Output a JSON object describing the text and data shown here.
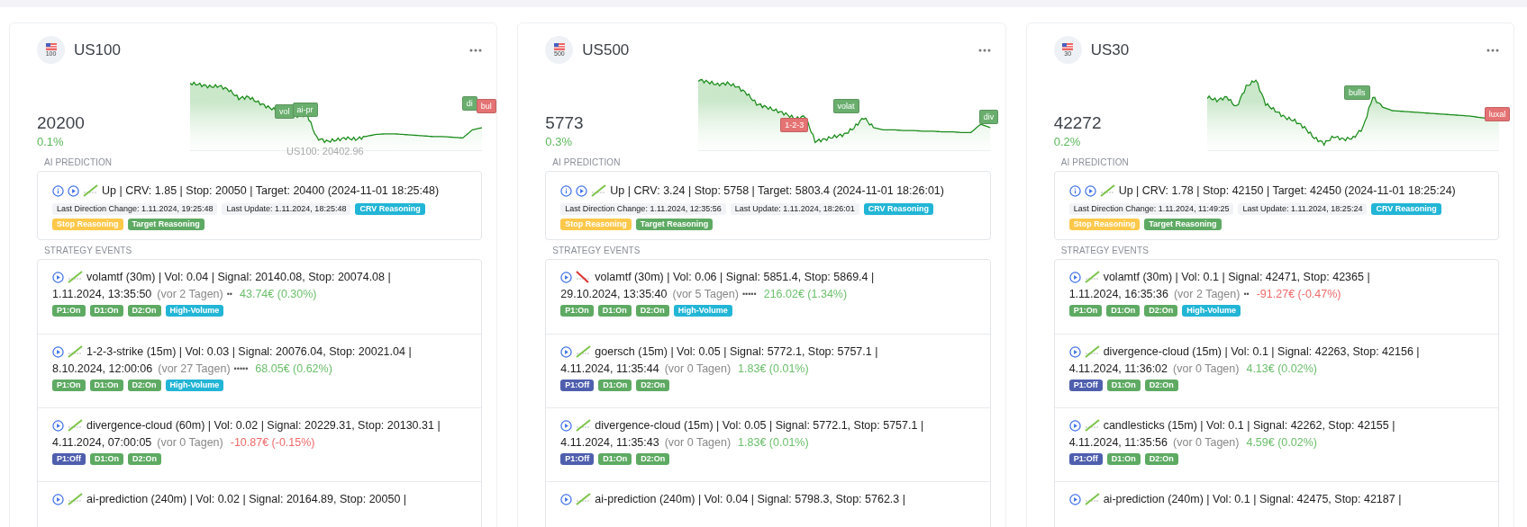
{
  "cards": [
    {
      "symbol": "US100",
      "flag_label": "100",
      "price": "20200",
      "change": "0.1%",
      "chart_markers": [
        {
          "label": "vol",
          "color": "#6aae6e"
        },
        {
          "label": "ai-pr",
          "color": "#6aae6e"
        },
        {
          "label": "di",
          "color": "#6aae6e"
        },
        {
          "label": "bul",
          "color": "#e57373"
        }
      ],
      "tooltip": {
        "series": "US100:",
        "value": "20402.96"
      },
      "section_prediction": "AI PREDICTION",
      "prediction": {
        "rising": true,
        "summary": "Up | CRV: 1.85 | Stop: 20050 | Target: 20400 (2024-11-01 18:25:48)",
        "tags": [
          {
            "kind": "info",
            "label": "Last Direction Change: 1.11.2024, 19:25:48"
          },
          {
            "kind": "info",
            "label": "Last Update: 1.11.2024, 18:25:48"
          },
          {
            "kind": "crv",
            "label": "CRV Reasoning"
          },
          {
            "kind": "stop",
            "label": "Stop Reasoning"
          },
          {
            "kind": "target",
            "label": "Target Reasoning"
          }
        ]
      },
      "section_events": "STRATEGY EVENTS",
      "events": [
        {
          "rising": true,
          "title": "volamtf (30m) | Vol: 0.04 | Signal: 20140.08, Stop: 20074.08 |",
          "date": "1.11.2024, 13:35:50",
          "age": "(vor 2 Tagen)",
          "dots": "••",
          "pnl": "43.74€ (0.30%)",
          "negative": false,
          "tags": [
            {
              "kind": "on",
              "label": "P1:On"
            },
            {
              "kind": "on",
              "label": "D1:On"
            },
            {
              "kind": "on",
              "label": "D2:On"
            },
            {
              "kind": "volume",
              "label": "High-Volume"
            }
          ]
        },
        {
          "rising": true,
          "title": "1-2-3-strike (15m) | Vol: 0.03 | Signal: 20076.04, Stop: 20021.04 |",
          "date": "8.10.2024, 12:00:06",
          "age": "(vor 27 Tagen)",
          "dots": "•••••",
          "pnl": "68.05€ (0.62%)",
          "negative": false,
          "tags": [
            {
              "kind": "on",
              "label": "P1:On"
            },
            {
              "kind": "on",
              "label": "D1:On"
            },
            {
              "kind": "on",
              "label": "D2:On"
            },
            {
              "kind": "volume",
              "label": "High-Volume"
            }
          ]
        },
        {
          "rising": true,
          "title": "divergence-cloud (60m) | Vol: 0.02 | Signal: 20229.31, Stop: 20130.31 |",
          "date": "4.11.2024, 07:00:05",
          "age": "(vor 0 Tagen)",
          "pnl": "-10.87€ (-0.15%)",
          "negative": true,
          "tags": [
            {
              "kind": "off",
              "label": "P1:Off"
            },
            {
              "kind": "on",
              "label": "D1:On"
            },
            {
              "kind": "on",
              "label": "D2:On"
            }
          ]
        },
        {
          "rising": true,
          "title": "ai-prediction (240m) | Vol: 0.02 | Signal: 20164.89, Stop: 20050 |"
        }
      ]
    },
    {
      "symbol": "US500",
      "flag_label": "500",
      "price": "5773",
      "change": "0.3%",
      "chart_markers": [
        {
          "label": "1-2-3",
          "color": "#e57373"
        },
        {
          "label": "volat",
          "color": "#6aae6e"
        },
        {
          "label": "div",
          "color": "#6aae6e"
        }
      ],
      "section_prediction": "AI PREDICTION",
      "prediction": {
        "rising": true,
        "summary": "Up | CRV: 3.24 | Stop: 5758 | Target: 5803.4 (2024-11-01 18:26:01)",
        "tags": [
          {
            "kind": "info",
            "label": "Last Direction Change: 1.11.2024, 12:35:56"
          },
          {
            "kind": "info",
            "label": "Last Update: 1.11.2024, 18:26:01"
          },
          {
            "kind": "crv",
            "label": "CRV Reasoning"
          },
          {
            "kind": "stop",
            "label": "Stop Reasoning"
          },
          {
            "kind": "target",
            "label": "Target Reasoning"
          }
        ]
      },
      "section_events": "STRATEGY EVENTS",
      "events": [
        {
          "rising": false,
          "title": "volamtf (30m) | Vol: 0.06 | Signal: 5851.4, Stop: 5869.4 |",
          "date": "29.10.2024, 13:35:40",
          "age": "(vor 5 Tagen)",
          "dots": "•••••",
          "pnl": "216.02€ (1.34%)",
          "negative": false,
          "tags": [
            {
              "kind": "on",
              "label": "P1:On"
            },
            {
              "kind": "on",
              "label": "D1:On"
            },
            {
              "kind": "on",
              "label": "D2:On"
            },
            {
              "kind": "volume",
              "label": "High-Volume"
            }
          ]
        },
        {
          "rising": true,
          "title": "goersch (15m) | Vol: 0.05 | Signal: 5772.1, Stop: 5757.1 |",
          "date": "4.11.2024, 11:35:44",
          "age": "(vor 0 Tagen)",
          "pnl": "1.83€ (0.01%)",
          "negative": false,
          "tags": [
            {
              "kind": "off",
              "label": "P1:Off"
            },
            {
              "kind": "on",
              "label": "D1:On"
            },
            {
              "kind": "on",
              "label": "D2:On"
            }
          ]
        },
        {
          "rising": true,
          "title": "divergence-cloud (15m) | Vol: 0.05 | Signal: 5772.1, Stop: 5757.1 |",
          "date": "4.11.2024, 11:35:43",
          "age": "(vor 0 Tagen)",
          "pnl": "1.83€ (0.01%)",
          "negative": false,
          "tags": [
            {
              "kind": "off",
              "label": "P1:Off"
            },
            {
              "kind": "on",
              "label": "D1:On"
            },
            {
              "kind": "on",
              "label": "D2:On"
            }
          ]
        },
        {
          "rising": true,
          "title": "ai-prediction (240m) | Vol: 0.04 | Signal: 5798.3, Stop: 5762.3 |"
        }
      ]
    },
    {
      "symbol": "US30",
      "flag_label": "30",
      "price": "42272",
      "change": "0.2%",
      "chart_markers": [
        {
          "label": "bulls",
          "color": "#6aae6e"
        },
        {
          "label": "luxal",
          "color": "#e57373"
        }
      ],
      "section_prediction": "AI PREDICTION",
      "prediction": {
        "rising": true,
        "summary": "Up | CRV: 1.78 | Stop: 42150 | Target: 42450 (2024-11-01 18:25:24)",
        "tags": [
          {
            "kind": "info",
            "label": "Last Direction Change: 1.11.2024, 11:49:25"
          },
          {
            "kind": "info",
            "label": "Last Update: 1.11.2024, 18:25:24"
          },
          {
            "kind": "crv",
            "label": "CRV Reasoning"
          },
          {
            "kind": "stop",
            "label": "Stop Reasoning"
          },
          {
            "kind": "target",
            "label": "Target Reasoning"
          }
        ]
      },
      "section_events": "STRATEGY EVENTS",
      "events": [
        {
          "rising": true,
          "title": "volamtf (30m) | Vol: 0.1 | Signal: 42471, Stop: 42365 |",
          "date": "1.11.2024, 16:35:36",
          "age": "(vor 2 Tagen)",
          "dots": "••",
          "pnl": "-91.27€ (-0.47%)",
          "negative": true,
          "tags": [
            {
              "kind": "on",
              "label": "P1:On"
            },
            {
              "kind": "on",
              "label": "D1:On"
            },
            {
              "kind": "on",
              "label": "D2:On"
            },
            {
              "kind": "volume",
              "label": "High-Volume"
            }
          ]
        },
        {
          "rising": true,
          "title": "divergence-cloud (15m) | Vol: 0.1 | Signal: 42263, Stop: 42156 |",
          "date": "4.11.2024, 11:36:02",
          "age": "(vor 0 Tagen)",
          "pnl": "4.13€ (0.02%)",
          "negative": false,
          "tags": [
            {
              "kind": "off",
              "label": "P1:Off"
            },
            {
              "kind": "on",
              "label": "D1:On"
            },
            {
              "kind": "on",
              "label": "D2:On"
            }
          ]
        },
        {
          "rising": true,
          "title": "candlesticks (15m) | Vol: 0.1 | Signal: 42262, Stop: 42155 |",
          "date": "4.11.2024, 11:35:56",
          "age": "(vor 0 Tagen)",
          "pnl": "4.59€ (0.02%)",
          "negative": false,
          "tags": [
            {
              "kind": "off",
              "label": "P1:Off"
            },
            {
              "kind": "on",
              "label": "D1:On"
            },
            {
              "kind": "on",
              "label": "D2:On"
            }
          ]
        },
        {
          "rising": true,
          "title": "ai-prediction (240m) | Vol: 0.1 | Signal: 42475, Stop: 42187 |"
        }
      ]
    }
  ]
}
